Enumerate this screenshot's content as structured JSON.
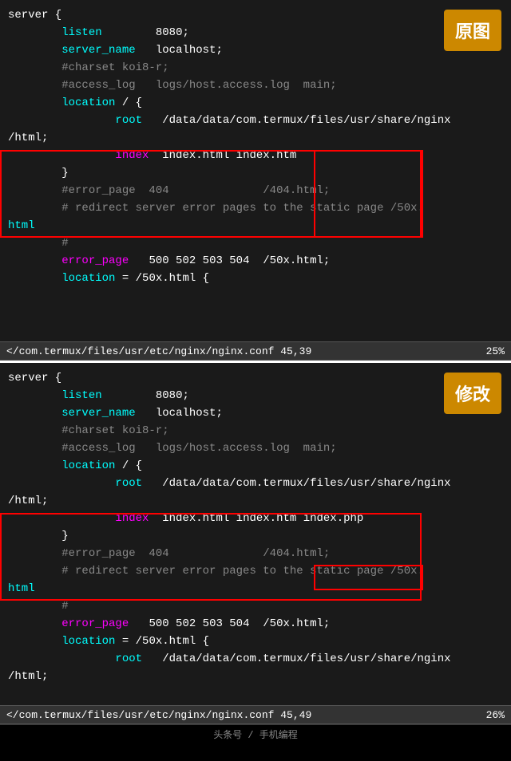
{
  "top_panel": {
    "badge_label": "原图",
    "lines": [
      {
        "text": "server {",
        "type": "normal"
      },
      {
        "text": "        listen        8080;",
        "type": "normal"
      },
      {
        "text": "        server_name   localhost;",
        "type": "normal"
      },
      {
        "text": "",
        "type": "normal"
      },
      {
        "text": "        #charset koi8-r;",
        "type": "comment"
      },
      {
        "text": "",
        "type": "normal"
      },
      {
        "text": "        #access_log   logs/host.access.log  main;",
        "type": "comment"
      },
      {
        "text": "",
        "type": "normal"
      },
      {
        "text": "        location / {",
        "type": "location"
      },
      {
        "text": "                root   /data/data/com.termux/files/usr/share/nginx",
        "type": "normal"
      },
      {
        "text": "/html;",
        "type": "normal"
      },
      {
        "text": "                index  index.html index.htm",
        "type": "index"
      },
      {
        "text": "        }",
        "type": "normal"
      },
      {
        "text": "",
        "type": "normal"
      },
      {
        "text": "        #error_page  404              /404.html;",
        "type": "comment"
      },
      {
        "text": "",
        "type": "normal"
      },
      {
        "text": "        # redirect server error pages to the static page /50x.",
        "type": "comment2"
      },
      {
        "text": "html",
        "type": "normal"
      },
      {
        "text": "        #",
        "type": "comment"
      },
      {
        "text": "        error_page   500 502 503 504  /50x.html;",
        "type": "error_page"
      },
      {
        "text": "        location = /50x.html {",
        "type": "location"
      }
    ],
    "status_text": "</com.termux/files/usr/etc/nginx/nginx.conf 45,39",
    "status_percent": "25%"
  },
  "bottom_panel": {
    "badge_label": "修改",
    "lines": [
      {
        "text": "server {",
        "type": "normal"
      },
      {
        "text": "        listen        8080;",
        "type": "normal"
      },
      {
        "text": "        server_name   localhost;",
        "type": "normal"
      },
      {
        "text": "",
        "type": "normal"
      },
      {
        "text": "        #charset koi8-r;",
        "type": "comment"
      },
      {
        "text": "",
        "type": "normal"
      },
      {
        "text": "        #access_log   logs/host.access.log  main;",
        "type": "comment"
      },
      {
        "text": "",
        "type": "normal"
      },
      {
        "text": "        location / {",
        "type": "location"
      },
      {
        "text": "                root   /data/data/com.termux/files/usr/share/nginx",
        "type": "normal"
      },
      {
        "text": "/html;",
        "type": "normal"
      },
      {
        "text": "                index  index.html index.htm index.php",
        "type": "index2"
      },
      {
        "text": "        }",
        "type": "normal"
      },
      {
        "text": "",
        "type": "normal"
      },
      {
        "text": "        #error_page  404              /404.html;",
        "type": "comment"
      },
      {
        "text": "",
        "type": "normal"
      },
      {
        "text": "        # redirect server error pages to the static page /50x.",
        "type": "comment2"
      },
      {
        "text": "html",
        "type": "normal"
      },
      {
        "text": "        #",
        "type": "comment"
      },
      {
        "text": "        error_page   500 502 503 504  /50x.html;",
        "type": "error_page"
      },
      {
        "text": "        location = /50x.html {",
        "type": "location"
      },
      {
        "text": "                root   /data/data/com.termux/files/usr/share/nginx",
        "type": "normal"
      },
      {
        "text": "/html;",
        "type": "normal"
      }
    ],
    "status_text": "</com.termux/files/usr/etc/nginx/nginx.conf 45,49",
    "status_percent": "26%"
  },
  "footer_text": "头条号 / 手机编程"
}
